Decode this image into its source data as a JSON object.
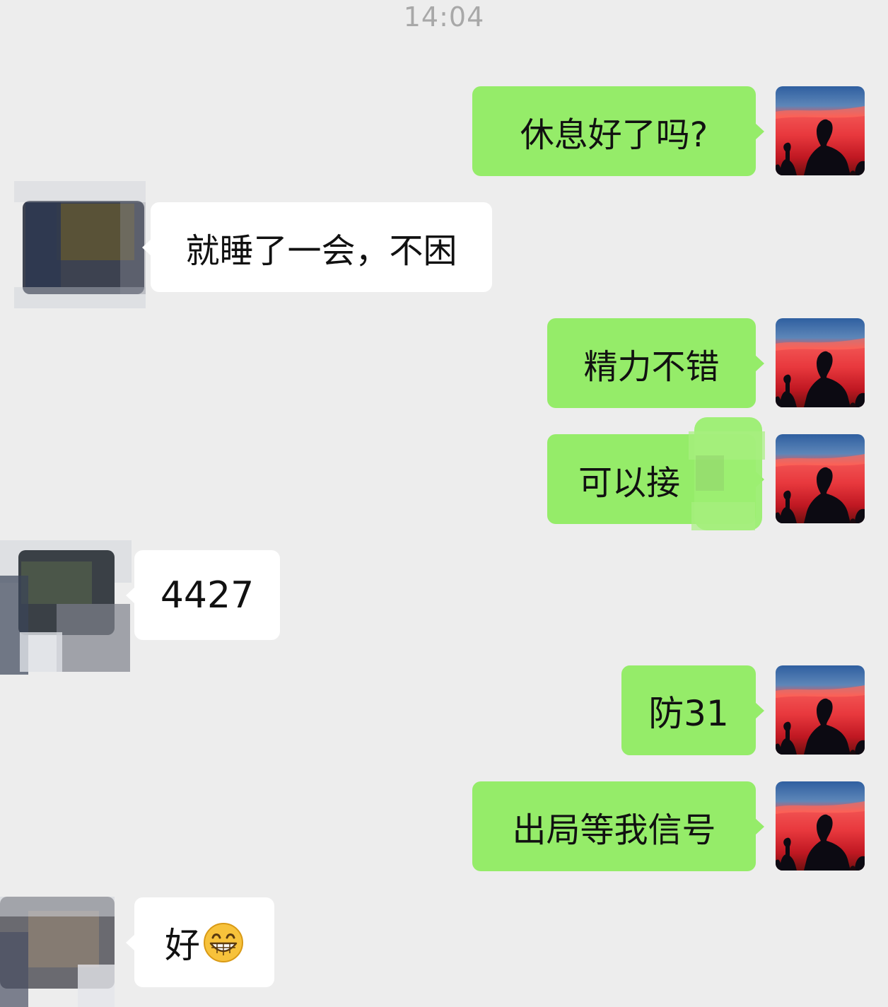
{
  "timestamp": "14:04",
  "messages": [
    {
      "side": "out",
      "text": "休息好了吗?"
    },
    {
      "side": "in",
      "text": "就睡了一会，不困"
    },
    {
      "side": "out",
      "text": "精力不错"
    },
    {
      "side": "out",
      "text": "可以接"
    },
    {
      "side": "in",
      "text": "4427"
    },
    {
      "side": "out",
      "text": "防31"
    },
    {
      "side": "out",
      "text": "出局等我信号"
    },
    {
      "side": "in",
      "text": "好",
      "emoji": "grinning-face-icon"
    }
  ],
  "colors": {
    "background": "#ededed",
    "outgoing_bubble": "#95ec69",
    "incoming_bubble": "#ffffff",
    "timestamp_text": "#a8a8a8"
  }
}
